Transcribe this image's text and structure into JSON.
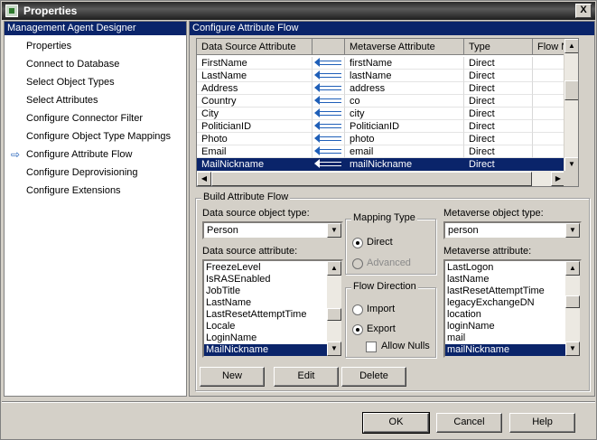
{
  "window": {
    "title": "Properties",
    "close_glyph": "X"
  },
  "left": {
    "header": "Management Agent Designer",
    "items": [
      {
        "label": "Properties"
      },
      {
        "label": "Connect to Database"
      },
      {
        "label": "Select Object Types"
      },
      {
        "label": "Select Attributes"
      },
      {
        "label": "Configure Connector Filter"
      },
      {
        "label": "Configure Object Type Mappings"
      },
      {
        "label": "Configure Attribute Flow",
        "current": true
      },
      {
        "label": "Configure Deprovisioning"
      },
      {
        "label": "Configure Extensions"
      }
    ]
  },
  "right": {
    "header": "Configure Attribute Flow",
    "grid": {
      "columns": [
        "Data Source Attribute",
        "",
        "Metaverse Attribute",
        "Type",
        "Flow Nu"
      ],
      "rows": [
        {
          "source": "FirstName",
          "metaverse": "firstName",
          "type": "Direct"
        },
        {
          "source": "LastName",
          "metaverse": "lastName",
          "type": "Direct"
        },
        {
          "source": "Address",
          "metaverse": "address",
          "type": "Direct"
        },
        {
          "source": "Country",
          "metaverse": "co",
          "type": "Direct"
        },
        {
          "source": "City",
          "metaverse": "city",
          "type": "Direct"
        },
        {
          "source": "PoliticianID",
          "metaverse": "PoliticianID",
          "type": "Direct"
        },
        {
          "source": "Photo",
          "metaverse": "photo",
          "type": "Direct"
        },
        {
          "source": "Email",
          "metaverse": "email",
          "type": "Direct"
        },
        {
          "source": "MailNickname",
          "metaverse": "mailNickname",
          "type": "Direct",
          "selected": true
        }
      ]
    },
    "build": {
      "legend": "Build Attribute Flow",
      "ds_object_type_label": "Data source object type:",
      "ds_object_type_value": "Person",
      "ds_attribute_label": "Data source attribute:",
      "ds_attributes": [
        "FreezeLevel",
        "IsRASEnabled",
        "JobTitle",
        "LastName",
        "LastResetAttemptTime",
        "Locale",
        "LoginName",
        "MailNickname"
      ],
      "ds_selected": "MailNickname",
      "mapping_type": {
        "legend": "Mapping Type",
        "direct": "Direct",
        "advanced": "Advanced",
        "selected": "Direct"
      },
      "flow_direction": {
        "legend": "Flow Direction",
        "import": "Import",
        "export": "Export",
        "selected": "Export",
        "allow_nulls": "Allow Nulls",
        "allow_nulls_checked": false
      },
      "mv_object_type_label": "Metaverse object type:",
      "mv_object_type_value": "person",
      "mv_attribute_label": "Metaverse attribute:",
      "mv_attributes": [
        "LastLogon",
        "lastName",
        "lastResetAttemptTime",
        "legacyExchangeDN",
        "location",
        "loginName",
        "mail",
        "mailNickname"
      ],
      "mv_selected": "mailNickname",
      "new_label": "New",
      "edit_label": "Edit",
      "delete_label": "Delete"
    }
  },
  "footer": {
    "ok": "OK",
    "cancel": "Cancel",
    "help": "Help"
  },
  "colors": {
    "selection": "#0a246a",
    "arrow": "#1f5fb8",
    "face": "#d4d0c8"
  }
}
